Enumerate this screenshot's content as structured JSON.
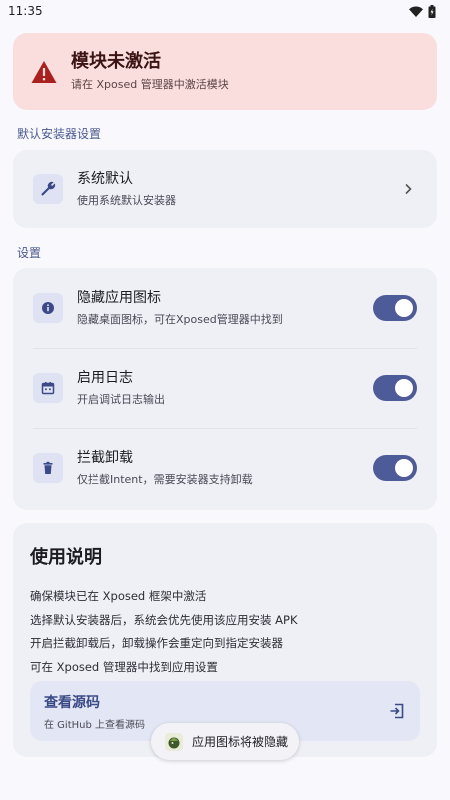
{
  "status_bar": {
    "time": "11:35"
  },
  "warning": {
    "title": "模块未激活",
    "subtitle": "请在 Xposed 管理器中激活模块",
    "color": "#fadede"
  },
  "installer_section": {
    "label": "默认安装器设置",
    "item": {
      "title": "系统默认",
      "subtitle": "使用系统默认安装器",
      "icon": "wrench-icon"
    }
  },
  "settings_section": {
    "label": "设置",
    "items": [
      {
        "title": "隐藏应用图标",
        "subtitle": "隐藏桌面图标，可在Xposed管理器中找到",
        "enabled": true,
        "icon": "info-icon"
      },
      {
        "title": "启用日志",
        "subtitle": "开启调试日志输出",
        "enabled": true,
        "icon": "calendar-icon"
      },
      {
        "title": "拦截卸载",
        "subtitle": "仅拦截Intent，需要安装器支持卸载",
        "enabled": true,
        "icon": "trash-icon"
      }
    ]
  },
  "usage": {
    "title": "使用说明",
    "lines": [
      "确保模块已在 Xposed 框架中激活",
      "选择默认安装器后，系统会优先使用该应用安装 APK",
      "开启拦截卸载后，卸载操作会重定向到指定安装器",
      "可在 Xposed 管理器中找到应用设置"
    ]
  },
  "source": {
    "title": "查看源码",
    "subtitle": "在 GitHub 上查看源码",
    "icon": "open-external-icon"
  },
  "toast": {
    "text": "应用图标将被隐藏"
  },
  "colors": {
    "accent": "#4d5b99",
    "card": "#efeff6",
    "background": "#f8f8fd"
  }
}
